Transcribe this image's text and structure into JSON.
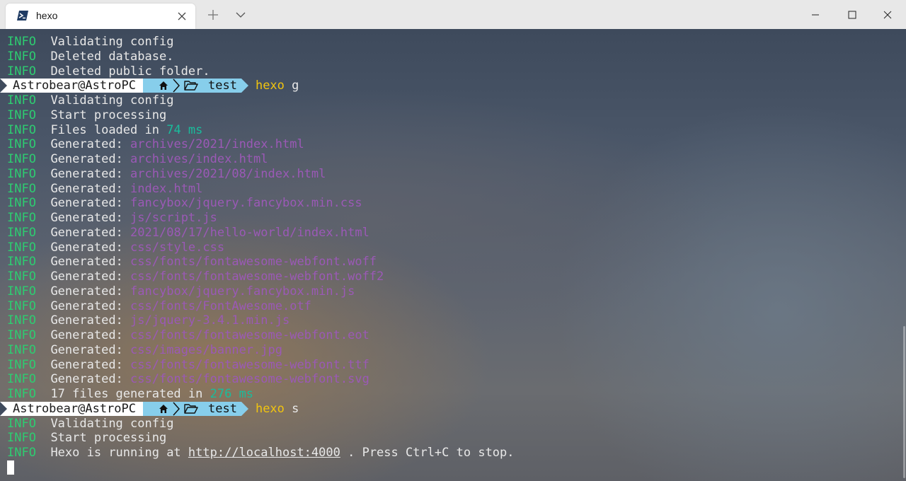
{
  "window": {
    "tab_title": "hexo",
    "icons": {
      "tab": "powershell-icon",
      "close": "close-icon",
      "new_tab": "plus-icon",
      "dropdown": "chevron-down-icon"
    }
  },
  "colors": {
    "info": "#2ecc71",
    "number": "#1abc9c",
    "path": "#9b59b6",
    "command": "#f1c40f",
    "prompt_user_bg": "#ffffff",
    "prompt_path_bg": "#87ceeb"
  },
  "terminal": {
    "info_tag": "INFO",
    "prompt": {
      "user_host": "Astrobear@AstroPC",
      "folder": "test"
    },
    "lines": [
      {
        "text": "Validating config"
      },
      {
        "text": "Deleted database."
      },
      {
        "text": "Deleted public folder."
      },
      {
        "command": "hexo",
        "arg": "g"
      },
      {
        "text": "Validating config"
      },
      {
        "text": "Start processing"
      },
      {
        "text": "Files loaded in",
        "num": "74 ms"
      },
      {
        "label": "Generated:",
        "path": "archives/2021/index.html"
      },
      {
        "label": "Generated:",
        "path": "archives/index.html"
      },
      {
        "label": "Generated:",
        "path": "archives/2021/08/index.html"
      },
      {
        "label": "Generated:",
        "path": "index.html"
      },
      {
        "label": "Generated:",
        "path": "fancybox/jquery.fancybox.min.css"
      },
      {
        "label": "Generated:",
        "path": "js/script.js"
      },
      {
        "label": "Generated:",
        "path": "2021/08/17/hello-world/index.html"
      },
      {
        "label": "Generated:",
        "path": "css/style.css"
      },
      {
        "label": "Generated:",
        "path": "css/fonts/fontawesome-webfont.woff"
      },
      {
        "label": "Generated:",
        "path": "css/fonts/fontawesome-webfont.woff2"
      },
      {
        "label": "Generated:",
        "path": "fancybox/jquery.fancybox.min.js"
      },
      {
        "label": "Generated:",
        "path": "css/fonts/FontAwesome.otf"
      },
      {
        "label": "Generated:",
        "path": "js/jquery-3.4.1.min.js"
      },
      {
        "label": "Generated:",
        "path": "css/fonts/fontawesome-webfont.eot"
      },
      {
        "label": "Generated:",
        "path": "css/images/banner.jpg"
      },
      {
        "label": "Generated:",
        "path": "css/fonts/fontawesome-webfont.ttf"
      },
      {
        "label": "Generated:",
        "path": "css/fonts/fontawesome-webfont.svg"
      },
      {
        "text": "17 files generated in",
        "num": "276 ms"
      },
      {
        "command": "hexo",
        "arg": "s"
      },
      {
        "text": "Validating config"
      },
      {
        "text": "Start processing"
      },
      {
        "text": "Hexo is running at",
        "link": "http://localhost:4000",
        "tail": ". Press Ctrl+C to stop."
      }
    ]
  }
}
